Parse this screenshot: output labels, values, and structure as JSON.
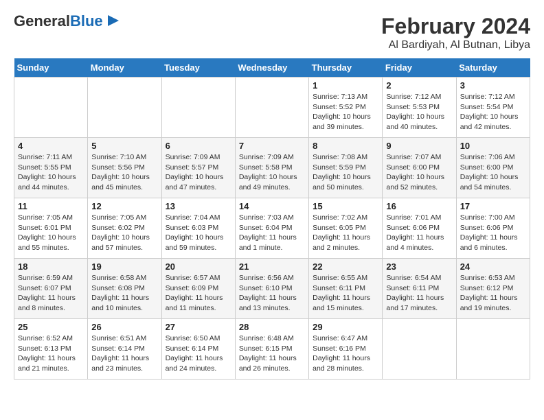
{
  "logo": {
    "text_general": "General",
    "text_blue": "Blue"
  },
  "title": "February 2024",
  "subtitle": "Al Bardiyah, Al Butnan, Libya",
  "headers": [
    "Sunday",
    "Monday",
    "Tuesday",
    "Wednesday",
    "Thursday",
    "Friday",
    "Saturday"
  ],
  "weeks": [
    [
      {
        "day": "",
        "info": ""
      },
      {
        "day": "",
        "info": ""
      },
      {
        "day": "",
        "info": ""
      },
      {
        "day": "",
        "info": ""
      },
      {
        "day": "1",
        "info": "Sunrise: 7:13 AM\nSunset: 5:52 PM\nDaylight: 10 hours\nand 39 minutes."
      },
      {
        "day": "2",
        "info": "Sunrise: 7:12 AM\nSunset: 5:53 PM\nDaylight: 10 hours\nand 40 minutes."
      },
      {
        "day": "3",
        "info": "Sunrise: 7:12 AM\nSunset: 5:54 PM\nDaylight: 10 hours\nand 42 minutes."
      }
    ],
    [
      {
        "day": "4",
        "info": "Sunrise: 7:11 AM\nSunset: 5:55 PM\nDaylight: 10 hours\nand 44 minutes."
      },
      {
        "day": "5",
        "info": "Sunrise: 7:10 AM\nSunset: 5:56 PM\nDaylight: 10 hours\nand 45 minutes."
      },
      {
        "day": "6",
        "info": "Sunrise: 7:09 AM\nSunset: 5:57 PM\nDaylight: 10 hours\nand 47 minutes."
      },
      {
        "day": "7",
        "info": "Sunrise: 7:09 AM\nSunset: 5:58 PM\nDaylight: 10 hours\nand 49 minutes."
      },
      {
        "day": "8",
        "info": "Sunrise: 7:08 AM\nSunset: 5:59 PM\nDaylight: 10 hours\nand 50 minutes."
      },
      {
        "day": "9",
        "info": "Sunrise: 7:07 AM\nSunset: 6:00 PM\nDaylight: 10 hours\nand 52 minutes."
      },
      {
        "day": "10",
        "info": "Sunrise: 7:06 AM\nSunset: 6:00 PM\nDaylight: 10 hours\nand 54 minutes."
      }
    ],
    [
      {
        "day": "11",
        "info": "Sunrise: 7:05 AM\nSunset: 6:01 PM\nDaylight: 10 hours\nand 55 minutes."
      },
      {
        "day": "12",
        "info": "Sunrise: 7:05 AM\nSunset: 6:02 PM\nDaylight: 10 hours\nand 57 minutes."
      },
      {
        "day": "13",
        "info": "Sunrise: 7:04 AM\nSunset: 6:03 PM\nDaylight: 10 hours\nand 59 minutes."
      },
      {
        "day": "14",
        "info": "Sunrise: 7:03 AM\nSunset: 6:04 PM\nDaylight: 11 hours\nand 1 minute."
      },
      {
        "day": "15",
        "info": "Sunrise: 7:02 AM\nSunset: 6:05 PM\nDaylight: 11 hours\nand 2 minutes."
      },
      {
        "day": "16",
        "info": "Sunrise: 7:01 AM\nSunset: 6:06 PM\nDaylight: 11 hours\nand 4 minutes."
      },
      {
        "day": "17",
        "info": "Sunrise: 7:00 AM\nSunset: 6:06 PM\nDaylight: 11 hours\nand 6 minutes."
      }
    ],
    [
      {
        "day": "18",
        "info": "Sunrise: 6:59 AM\nSunset: 6:07 PM\nDaylight: 11 hours\nand 8 minutes."
      },
      {
        "day": "19",
        "info": "Sunrise: 6:58 AM\nSunset: 6:08 PM\nDaylight: 11 hours\nand 10 minutes."
      },
      {
        "day": "20",
        "info": "Sunrise: 6:57 AM\nSunset: 6:09 PM\nDaylight: 11 hours\nand 11 minutes."
      },
      {
        "day": "21",
        "info": "Sunrise: 6:56 AM\nSunset: 6:10 PM\nDaylight: 11 hours\nand 13 minutes."
      },
      {
        "day": "22",
        "info": "Sunrise: 6:55 AM\nSunset: 6:11 PM\nDaylight: 11 hours\nand 15 minutes."
      },
      {
        "day": "23",
        "info": "Sunrise: 6:54 AM\nSunset: 6:11 PM\nDaylight: 11 hours\nand 17 minutes."
      },
      {
        "day": "24",
        "info": "Sunrise: 6:53 AM\nSunset: 6:12 PM\nDaylight: 11 hours\nand 19 minutes."
      }
    ],
    [
      {
        "day": "25",
        "info": "Sunrise: 6:52 AM\nSunset: 6:13 PM\nDaylight: 11 hours\nand 21 minutes."
      },
      {
        "day": "26",
        "info": "Sunrise: 6:51 AM\nSunset: 6:14 PM\nDaylight: 11 hours\nand 23 minutes."
      },
      {
        "day": "27",
        "info": "Sunrise: 6:50 AM\nSunset: 6:14 PM\nDaylight: 11 hours\nand 24 minutes."
      },
      {
        "day": "28",
        "info": "Sunrise: 6:48 AM\nSunset: 6:15 PM\nDaylight: 11 hours\nand 26 minutes."
      },
      {
        "day": "29",
        "info": "Sunrise: 6:47 AM\nSunset: 6:16 PM\nDaylight: 11 hours\nand 28 minutes."
      },
      {
        "day": "",
        "info": ""
      },
      {
        "day": "",
        "info": ""
      }
    ]
  ]
}
